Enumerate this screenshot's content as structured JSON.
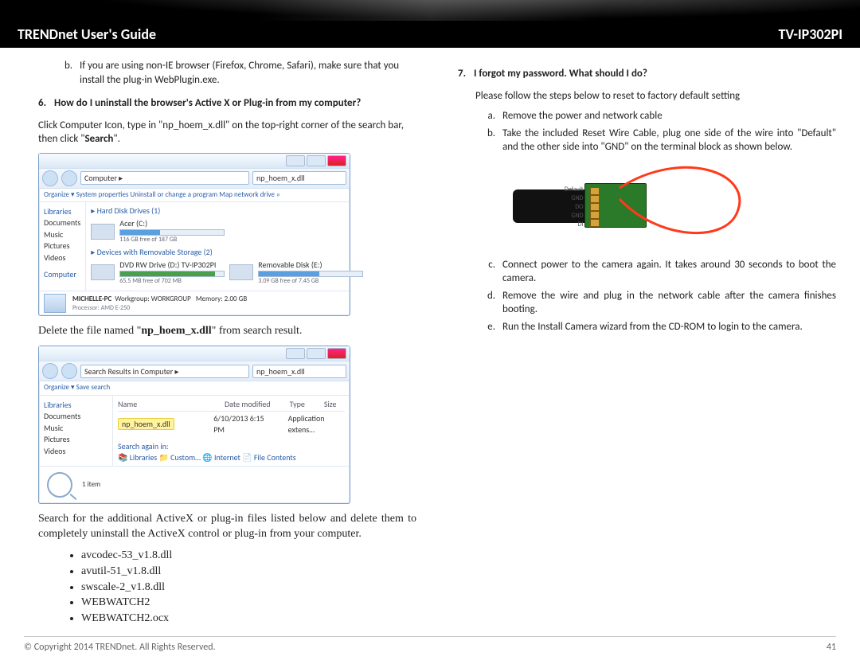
{
  "header": {
    "guide_title": "TRENDnet User's Guide",
    "model": "TV-IP302PI"
  },
  "left": {
    "b_item": "If you are using non-IE browser (Firefox, Chrome, Safari), make sure that you install the plug-in WebPlugin.exe.",
    "q6_num": "6.",
    "q6_text": "How do I uninstall the browser's Active X or Plug-in from my computer?",
    "p1a": "Click Computer Icon, type in \"np_hoem_x.dll\" on the top-right corner of the search bar, then click \"",
    "p1b": "Search",
    "p1c": "\".",
    "shot1": {
      "addr": "Computer  ▸",
      "search": "np_hoem_x.dll",
      "toolbar": "Organize ▾   System properties   Uninstall or change a program   Map network drive   »",
      "side": [
        "Libraries",
        "Documents",
        "Music",
        "Pictures",
        "Videos",
        "",
        "Computer"
      ],
      "sec1": "▸ Hard Disk Drives (1)",
      "drv1": "Acer (C:)",
      "drv1_sub": "116 GB free of 187 GB",
      "sec2": "▸ Devices with Removable Storage (2)",
      "drv2": "DVD RW Drive (D:) TV-IP302PI",
      "drv2_sub": "65.5 MB free of 702 MB",
      "drv3": "Removable Disk (E:)",
      "drv3_sub": "3.09 GB free of 7.45 GB",
      "foot_pc": "MICHELLE-PC",
      "foot_wg": "Workgroup: WORKGROUP",
      "foot_mem": "Memory: 2.00 GB",
      "foot_cpu": "Processor: AMD E-250"
    },
    "p2a": "Delete the file named \"",
    "p2b": "np_hoem_x.dll",
    "p2c": "\" from search result.",
    "shot2": {
      "addr": "Search Results in Computer  ▸",
      "search": "np_hoem_x.dll",
      "toolbar": "Organize ▾    Save search",
      "side": [
        "Libraries",
        "Documents",
        "Music",
        "Pictures",
        "Videos"
      ],
      "head": [
        "Name",
        "Date modified",
        "Type",
        "Size"
      ],
      "file": "np_hoem_x.dll",
      "date": "6/10/2013 6:15 PM",
      "type": "Application extens…",
      "again_lbl": "Search again in:",
      "again_opts": "📚 Libraries   📁 Custom…   🌐 Internet   📄 File Contents",
      "foot": "1 item"
    },
    "p3": "Search for the additional ActiveX or plug-in files listed below and delete them to completely uninstall the ActiveX control or plug-in from your computer.",
    "files": [
      "avcodec-53_v1.8.dll",
      "avutil-51_v1.8.dll",
      "swscale-2_v1.8.dll",
      "WEBWATCH2",
      "WEBWATCH2.ocx"
    ]
  },
  "right": {
    "q7_num": "7.",
    "q7_text": "I forgot my password. What should I do?",
    "intro": "Please follow the steps below to reset to factory default setting",
    "a": "Remove the power and network cable",
    "b": "Take the included Reset Wire Cable, plug one side of the wire into \"Default\" and the other side into \"GND\" on the terminal block as shown below.",
    "term_labels": [
      "Default",
      "GND",
      "DO",
      "GND",
      "DI"
    ],
    "c": "Connect power to the camera again. It takes around 30 seconds to boot the camera.",
    "d": "Remove the wire and plug in the network cable after the camera finishes booting.",
    "e": "Run the Install Camera wizard from the CD-ROM to login to the camera."
  },
  "footer": {
    "copyright": "© Copyright 2014 TRENDnet.  All Rights Reserved.",
    "page": "41"
  }
}
